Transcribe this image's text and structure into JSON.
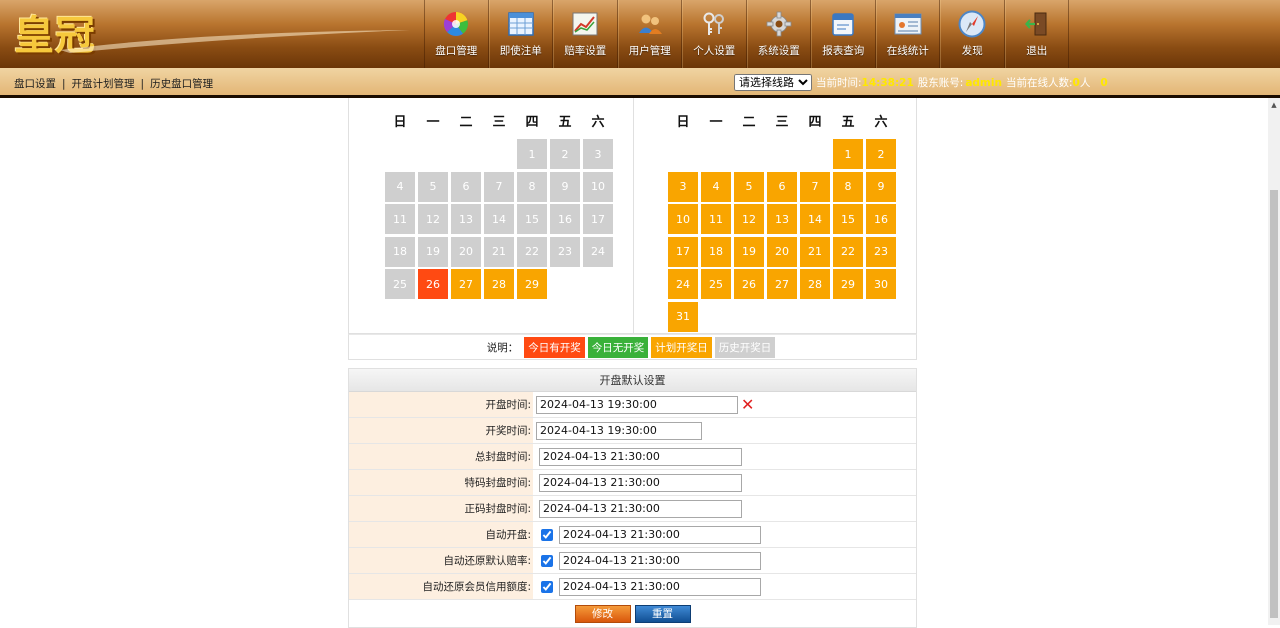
{
  "header": {
    "logo": "皇冠",
    "nav": [
      {
        "label": "盘口管理",
        "icon": "color-wheel-icon"
      },
      {
        "label": "即使注单",
        "icon": "table-icon"
      },
      {
        "label": "赔率设置",
        "icon": "chart-icon"
      },
      {
        "label": "用户管理",
        "icon": "users-icon"
      },
      {
        "label": "个人设置",
        "icon": "keys-icon"
      },
      {
        "label": "系统设置",
        "icon": "gear-icon"
      },
      {
        "label": "报表查询",
        "icon": "calendar-report-icon"
      },
      {
        "label": "在线统计",
        "icon": "stats-icon"
      },
      {
        "label": "发现",
        "icon": "compass-icon"
      },
      {
        "label": "退出",
        "icon": "exit-door-icon"
      }
    ]
  },
  "subbar": {
    "links": [
      "盘口设置",
      "开盘计划管理",
      "历史盘口管理"
    ],
    "separator": "|",
    "line_select": "请选择线路",
    "time_label": "当前时间:",
    "time": "14:38:21",
    "account_label": "股东账号:",
    "account": "admin",
    "online_label": "当前在线人数:",
    "online_count": "0",
    "online_unit": "人",
    "extra": "0"
  },
  "calendar": {
    "weekdays": [
      "日",
      "一",
      "二",
      "三",
      "四",
      "五",
      "六"
    ],
    "left_month": {
      "offset": 4,
      "days": 29,
      "today": 26,
      "history_until": 25
    },
    "right_month": {
      "offset": 5,
      "days": 31
    }
  },
  "legend": {
    "label": "说明：",
    "items": [
      "今日有开奖",
      "今日无开奖",
      "计划开奖日",
      "历史开奖日"
    ]
  },
  "settings": {
    "title": "开盘默认设置",
    "rows": [
      {
        "label": "开盘时间:",
        "value": "2024-04-13 19:30:00"
      },
      {
        "label": "开奖时间:",
        "value": "2024-04-13 19:30:00"
      },
      {
        "label": "总封盘时间:",
        "value": "2024-04-13 21:30:00"
      },
      {
        "label": "特码封盘时间:",
        "value": "2024-04-13 21:30:00"
      },
      {
        "label": "正码封盘时间:",
        "value": "2024-04-13 21:30:00"
      },
      {
        "label": "自动开盘:",
        "value": "2024-04-13 21:30:00",
        "checked": true
      },
      {
        "label": "自动还原默认赔率:",
        "value": "2024-04-13 21:30:00",
        "checked": true
      },
      {
        "label": "自动还原会员信用额度:",
        "value": "2024-04-13 21:30:00",
        "checked": true
      }
    ],
    "modify_label": "修改",
    "reset_label": "重置"
  }
}
